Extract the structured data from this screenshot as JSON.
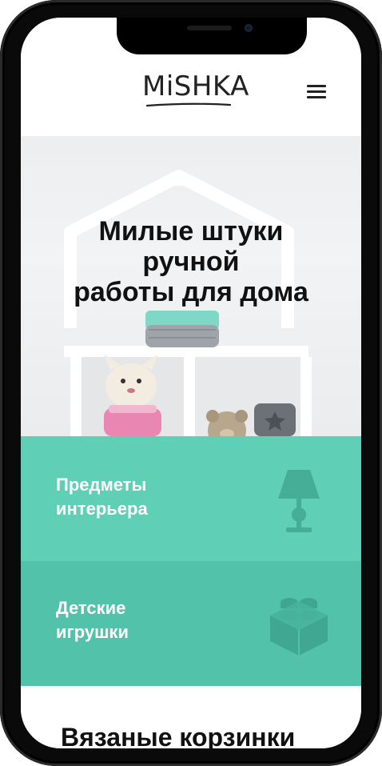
{
  "header": {
    "logo_text": "MiSHKA",
    "menu_icon": "hamburger-menu-icon"
  },
  "hero": {
    "title_line1": "Милые штуки",
    "title_line2": "ручной",
    "title_line3": "работы для дома"
  },
  "categories": [
    {
      "label": "Предметы\nинтерьера",
      "icon": "table-lamp-icon"
    },
    {
      "label": "Детские\nигрушки",
      "icon": "toy-brick-icon"
    }
  ],
  "next_section": {
    "title": "Вязаные корзинки"
  },
  "colors": {
    "accent": "#5fcfb6",
    "accent_dark": "#52c2ab",
    "text": "#111111",
    "frame": "#0a0a0a"
  }
}
